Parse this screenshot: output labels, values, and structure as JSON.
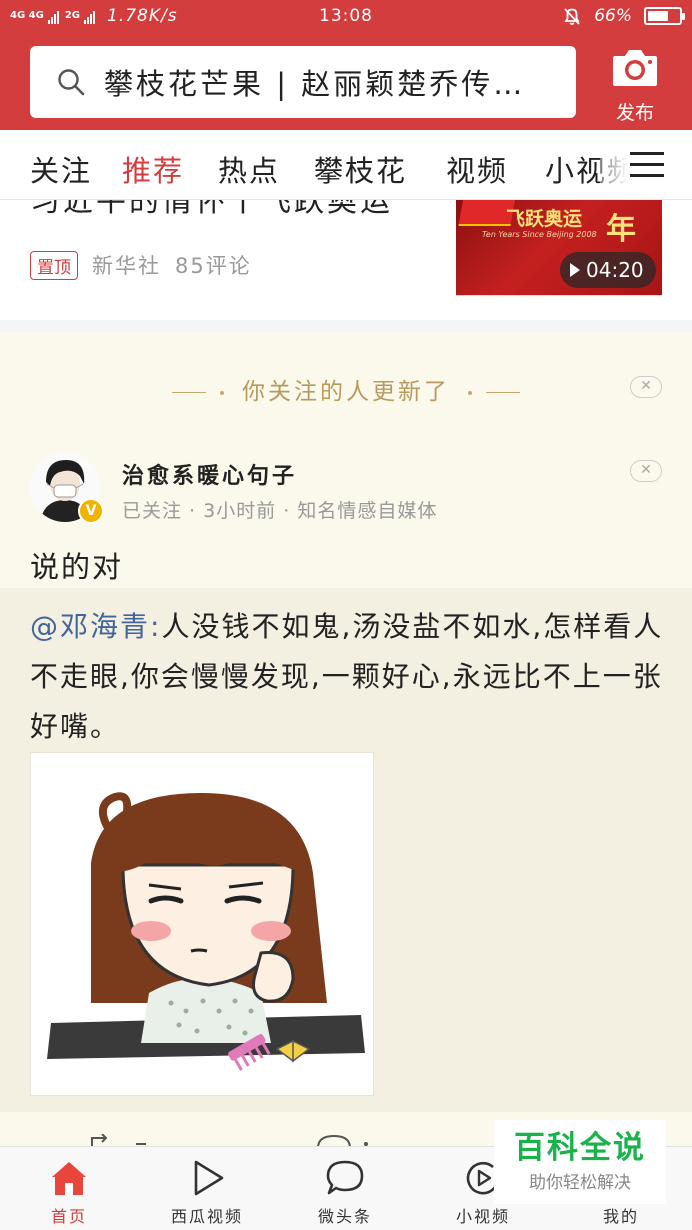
{
  "status_bar": {
    "network": "4G 4G",
    "network2": "2G",
    "speed": "1.78K/s",
    "time": "13:08",
    "battery_percent": "66%",
    "battery_level": 0.66
  },
  "header": {
    "search_text": "攀枝花芒果 | 赵丽颖楚乔传…",
    "publish_label": "发布"
  },
  "tabs": [
    "关注",
    "推荐",
    "热点",
    "攀枝花",
    "视频",
    "小视频"
  ],
  "active_tab": "推荐",
  "news": {
    "title": "习近平的情怀丨飞跃奥运",
    "badge": "置顶",
    "source": "新华社",
    "comments": "85评论",
    "thumb_title": "飞跃奥运",
    "thumb_subtitle": "Ten Years Since Beijing 2008",
    "thumb_year": "年",
    "duration": "04:20"
  },
  "follow": {
    "header": "你关注的人更新了",
    "close_label": "✕",
    "author_name": "治愈系暖心句子",
    "author_meta": "已关注 · 3小时前 · 知名情感自媒体",
    "verified_badge": "V",
    "post_text": "说的对",
    "quote_mention": "@邓海青:",
    "quote_body": "人没钱不如鬼,汤没盐不如水,怎样看人不走眼,你会慢慢发现,一颗好心,永远比不上一张好嘴。"
  },
  "bottom_nav": [
    {
      "label": "首页",
      "icon": "home-icon",
      "active": true
    },
    {
      "label": "西瓜视频",
      "icon": "play-icon",
      "active": false
    },
    {
      "label": "微头条",
      "icon": "chat-bubble-icon",
      "active": false
    },
    {
      "label": "小视频",
      "icon": "short-video-icon",
      "active": false
    },
    {
      "label": "我的",
      "icon": "user-icon",
      "active": false
    }
  ],
  "watermark": {
    "title": "百科全说",
    "subtitle": "助你轻松解决"
  },
  "colors": {
    "brand_red": "#d43d3d",
    "mention_blue": "#406599",
    "follow_bg": "#fbf8ec",
    "watermark_green": "#19b24b"
  }
}
